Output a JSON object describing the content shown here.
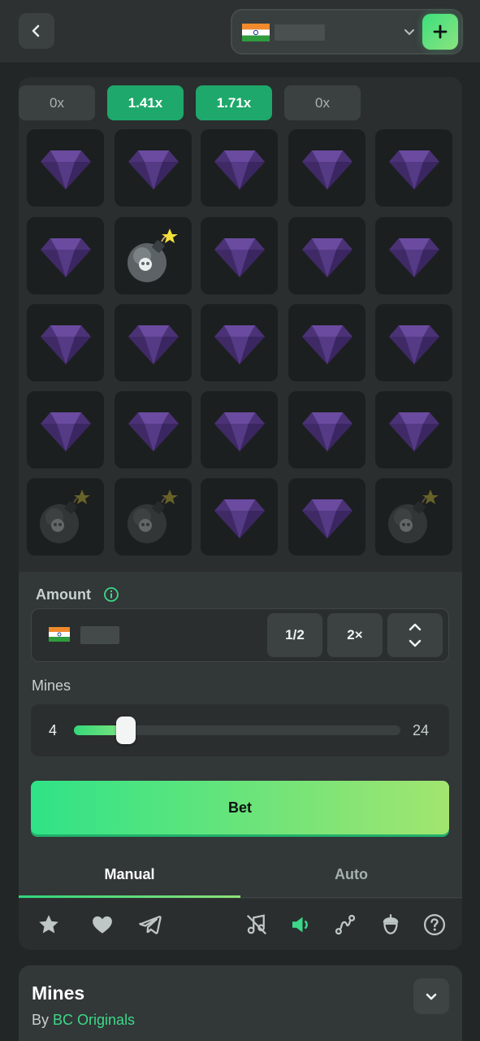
{
  "header": {
    "back_icon": "chevron-left-icon",
    "wallet": {
      "currency_flag": "india-flag-icon",
      "dropdown_icon": "chevron-down-icon",
      "add_icon": "plus-icon"
    }
  },
  "multipliers": [
    {
      "label": "0x",
      "active": false
    },
    {
      "label": "1.41x",
      "active": true
    },
    {
      "label": "1.71x",
      "active": true
    },
    {
      "label": "0x",
      "active": false
    }
  ],
  "grid": {
    "rows": [
      [
        "gem",
        "gem",
        "gem",
        "gem",
        "gem"
      ],
      [
        "gem",
        "bomb",
        "gem",
        "gem",
        "gem"
      ],
      [
        "gem",
        "gem",
        "gem",
        "gem",
        "gem"
      ],
      [
        "gem",
        "gem",
        "gem",
        "gem",
        "gem"
      ],
      [
        "bomb-dim",
        "bomb-dim",
        "gem",
        "gem",
        "bomb-dim"
      ]
    ]
  },
  "amount": {
    "label": "Amount",
    "info_icon": "info-icon",
    "half_label": "1/2",
    "double_label": "2×",
    "expand_icon": "chevron-up-down-icon"
  },
  "mines": {
    "label": "Mines",
    "value": "4",
    "max": "24",
    "min": 1,
    "slider_fraction": 0.13
  },
  "bet_label": "Bet",
  "tabs": [
    {
      "label": "Manual",
      "active": true
    },
    {
      "label": "Auto",
      "active": false
    }
  ],
  "toolbar_icons": [
    "star-icon",
    "heart-icon",
    "telegram-icon",
    "music-off-icon",
    "sound-icon",
    "route-icon",
    "acorn-icon",
    "help-icon"
  ],
  "info": {
    "title": "Mines",
    "by_prefix": "By",
    "provider": "BC Originals",
    "toggle_icon": "chevron-down-icon"
  },
  "colors": {
    "accent": "#2fe387",
    "active_multiplier": "#1ea86b",
    "gem": "#5b3f8c"
  }
}
